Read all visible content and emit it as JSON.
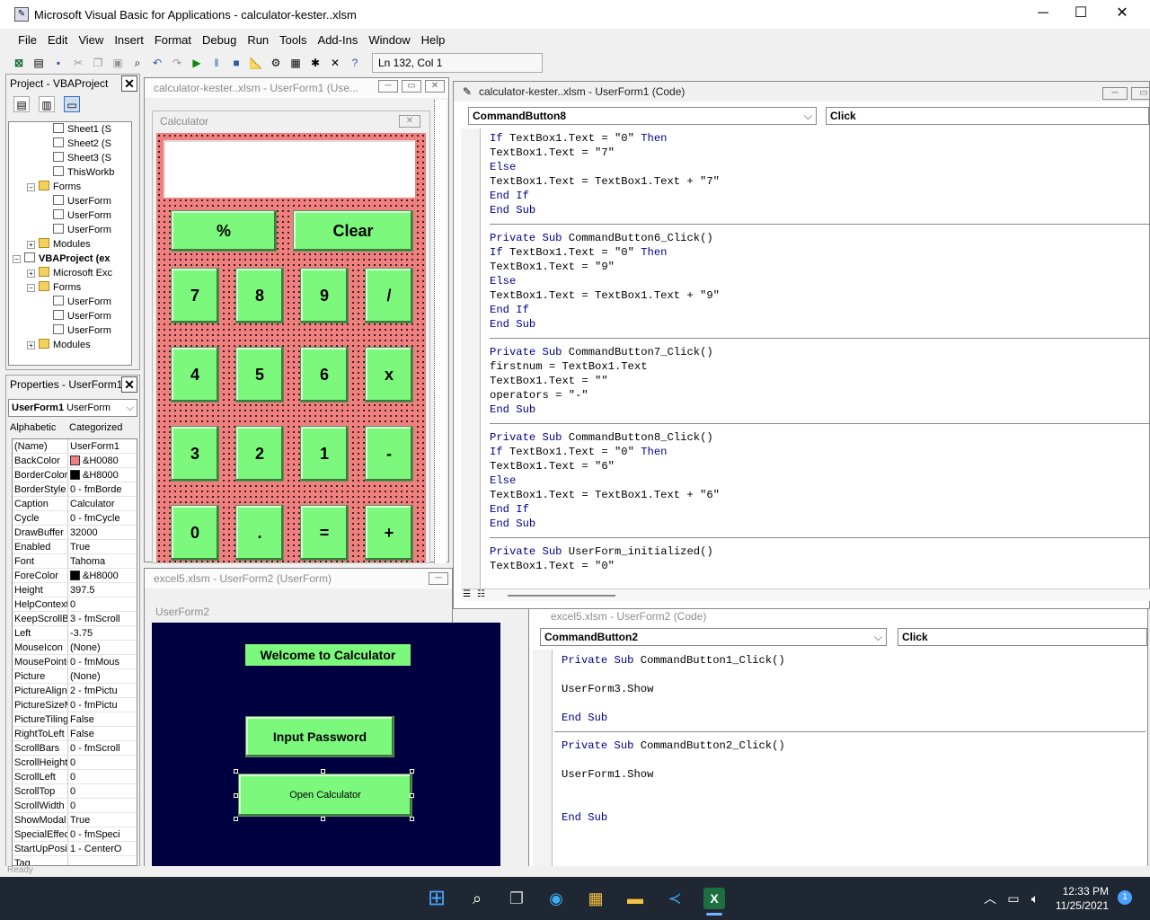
{
  "window": {
    "title": "Microsoft Visual Basic for Applications - calculator-kester..xlsm",
    "minimize": "─",
    "maximize": "☐",
    "close": "✕"
  },
  "menu": [
    "File",
    "Edit",
    "View",
    "Insert",
    "Format",
    "Debug",
    "Run",
    "Tools",
    "Add-Ins",
    "Window",
    "Help"
  ],
  "toolbar": {
    "position": "Ln 132, Col 1"
  },
  "project": {
    "title": "Project - VBAProject",
    "items": [
      {
        "label": "Sheet1 (S",
        "level": 3,
        "icon": "sheet"
      },
      {
        "label": "Sheet2 (S",
        "level": 3,
        "icon": "sheet"
      },
      {
        "label": "Sheet3 (S",
        "level": 3,
        "icon": "sheet"
      },
      {
        "label": "ThisWorkb",
        "level": 3,
        "icon": "sheet"
      },
      {
        "label": "Forms",
        "level": 2,
        "icon": "folder",
        "exp": "−"
      },
      {
        "label": "UserForm",
        "level": 3,
        "icon": "form"
      },
      {
        "label": "UserForm",
        "level": 3,
        "icon": "form"
      },
      {
        "label": "UserForm",
        "level": 3,
        "icon": "form"
      },
      {
        "label": "Modules",
        "level": 2,
        "icon": "folder",
        "exp": "+"
      },
      {
        "label": "VBAProject (ex",
        "level": 1,
        "icon": "project",
        "exp": "−",
        "bold": true
      },
      {
        "label": "Microsoft Exc",
        "level": 2,
        "icon": "folder",
        "exp": "+"
      },
      {
        "label": "Forms",
        "level": 2,
        "icon": "folder",
        "exp": "−"
      },
      {
        "label": "UserForm",
        "level": 3,
        "icon": "form"
      },
      {
        "label": "UserForm",
        "level": 3,
        "icon": "form"
      },
      {
        "label": "UserForm",
        "level": 3,
        "icon": "form"
      },
      {
        "label": "Modules",
        "level": 2,
        "icon": "folder",
        "exp": "+"
      }
    ]
  },
  "properties": {
    "title": "Properties - UserForm1",
    "object": "UserForm1",
    "object_type": "UserForm",
    "tab_alpha": "Alphabetic",
    "tab_cat": "Categorized",
    "rows": [
      {
        "n": "(Name)",
        "v": "UserForm1"
      },
      {
        "n": "BackColor",
        "v": "&H0080",
        "c": "#f08080"
      },
      {
        "n": "BorderColor",
        "v": "&H8000",
        "c": "#000000"
      },
      {
        "n": "BorderStyle",
        "v": "0 - fmBorde"
      },
      {
        "n": "Caption",
        "v": "Calculator"
      },
      {
        "n": "Cycle",
        "v": "0 - fmCycle"
      },
      {
        "n": "DrawBuffer",
        "v": "32000"
      },
      {
        "n": "Enabled",
        "v": "True"
      },
      {
        "n": "Font",
        "v": "Tahoma"
      },
      {
        "n": "ForeColor",
        "v": "&H8000",
        "c": "#000000"
      },
      {
        "n": "Height",
        "v": "397.5"
      },
      {
        "n": "HelpContextI",
        "v": "0"
      },
      {
        "n": "KeepScrollBa",
        "v": "3 - fmScroll"
      },
      {
        "n": "Left",
        "v": "-3.75"
      },
      {
        "n": "MouseIcon",
        "v": "(None)"
      },
      {
        "n": "MousePointe",
        "v": "0 - fmMous"
      },
      {
        "n": "Picture",
        "v": "(None)"
      },
      {
        "n": "PictureAlignm",
        "v": "2 - fmPictu"
      },
      {
        "n": "PictureSizeM",
        "v": "0 - fmPictu"
      },
      {
        "n": "PictureTiling",
        "v": "False"
      },
      {
        "n": "RightToLeft",
        "v": "False"
      },
      {
        "n": "ScrollBars",
        "v": "0 - fmScroll"
      },
      {
        "n": "ScrollHeight",
        "v": "0"
      },
      {
        "n": "ScrollLeft",
        "v": "0"
      },
      {
        "n": "ScrollTop",
        "v": "0"
      },
      {
        "n": "ScrollWidth",
        "v": "0"
      },
      {
        "n": "ShowModal",
        "v": "True"
      },
      {
        "n": "SpecialEffect",
        "v": "0 - fmSpeci"
      },
      {
        "n": "StartUpPositi",
        "v": "1 - CenterO"
      },
      {
        "n": "Tag",
        "v": ""
      }
    ]
  },
  "calc_designer": {
    "title": "calculator-kester..xlsm - UserForm1 (Use...",
    "form_caption": "Calculator",
    "buttons": [
      "%",
      "Clear",
      "7",
      "8",
      "9",
      "/",
      "4",
      "5",
      "6",
      "x",
      "3",
      "2",
      "1",
      "-",
      "0",
      ".",
      "=",
      "+"
    ]
  },
  "form2_designer": {
    "title": "excel5.xlsm - UserForm2 (UserForm)",
    "form_caption": "UserForm2",
    "welcome": "Welcome to Calculator",
    "input_password": "Input Password",
    "open_calculator": "Open Calculator"
  },
  "code1": {
    "title": "calculator-kester..xlsm - UserForm1 (Code)",
    "object": "CommandButton8",
    "proc": "Click",
    "blocks": [
      [
        "If TextBox1.Text = \"0\" Then",
        "TextBox1.Text = \"7\"",
        "Else",
        "TextBox1.Text = TextBox1.Text + \"7\"",
        "End If",
        "End Sub"
      ],
      [
        "Private Sub CommandButton6_Click()",
        "If TextBox1.Text = \"0\" Then",
        "TextBox1.Text = \"9\"",
        "Else",
        "TextBox1.Text = TextBox1.Text + \"9\"",
        "End If",
        "End Sub"
      ],
      [
        "Private Sub CommandButton7_Click()",
        "firstnum = TextBox1.Text",
        "TextBox1.Text = \"\"",
        "operators = \"-\"",
        "End Sub"
      ],
      [
        "Private Sub CommandButton8_Click()",
        "If TextBox1.Text = \"0\" Then",
        "TextBox1.Text = \"6\"",
        "Else",
        "TextBox1.Text = TextBox1.Text + \"6\"",
        "End If",
        "End Sub"
      ],
      [
        "Private Sub UserForm_initialized()",
        "TextBox1.Text = \"0\""
      ]
    ]
  },
  "code2": {
    "title": "excel5.xlsm - UserForm2 (Code)",
    "object": "CommandButton2",
    "proc": "Click",
    "blocks": [
      [
        "Private Sub CommandButton1_Click()",
        "",
        "UserForm3.Show",
        "",
        "End Sub"
      ],
      [
        "Private Sub CommandButton2_Click()",
        "",
        "UserForm1.Show",
        "",
        "",
        "End Sub"
      ]
    ]
  },
  "statusbar": {
    "text": "Ready"
  },
  "taskbar": {
    "time": "12:33 PM",
    "date": "11/25/2021",
    "badge": "1"
  }
}
